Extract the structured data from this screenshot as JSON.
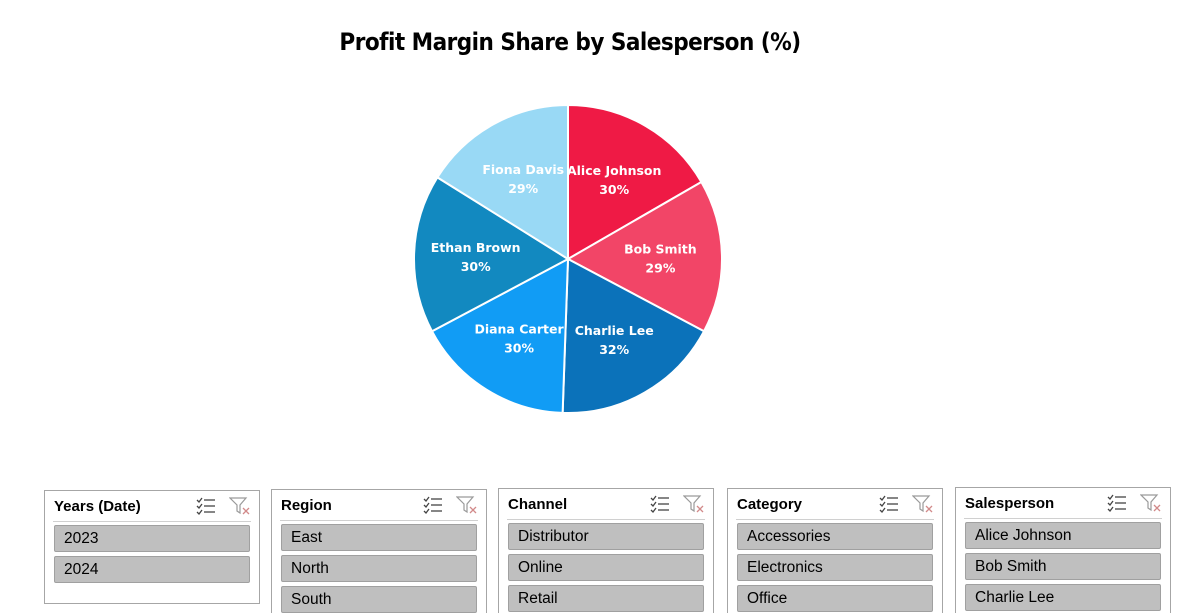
{
  "chart_data": {
    "type": "pie",
    "title": "Profit Margin Share by Salesperson (%)",
    "slices": [
      {
        "name": "Alice Johnson",
        "value": 30,
        "label": "30%",
        "color": "#EF1A45"
      },
      {
        "name": "Bob Smith",
        "value": 29,
        "label": "29%",
        "color": "#F24567"
      },
      {
        "name": "Charlie Lee",
        "value": 32,
        "label": "32%",
        "color": "#0B72BA"
      },
      {
        "name": "Diana Carter",
        "value": 30,
        "label": "30%",
        "color": "#119CF5"
      },
      {
        "name": "Ethan Brown",
        "value": 30,
        "label": "30%",
        "color": "#1289C0"
      },
      {
        "name": "Fiona Davis",
        "value": 29,
        "label": "29%",
        "color": "#99D9F5"
      }
    ],
    "data_labels": "inside",
    "legend": "none"
  },
  "slicers": [
    {
      "id": "years",
      "title": "Years (Date)",
      "items": [
        "2023",
        "2024"
      ]
    },
    {
      "id": "region",
      "title": "Region",
      "items": [
        "East",
        "North",
        "South"
      ]
    },
    {
      "id": "channel",
      "title": "Channel",
      "items": [
        "Distributor",
        "Online",
        "Retail"
      ]
    },
    {
      "id": "category",
      "title": "Category",
      "items": [
        "Accessories",
        "Electronics",
        "Office"
      ]
    },
    {
      "id": "salesperson",
      "title": "Salesperson",
      "items": [
        "Alice Johnson",
        "Bob Smith",
        "Charlie Lee"
      ]
    }
  ],
  "icons": {
    "multiselect": "multi-select-icon",
    "clear": "clear-filter-icon"
  }
}
